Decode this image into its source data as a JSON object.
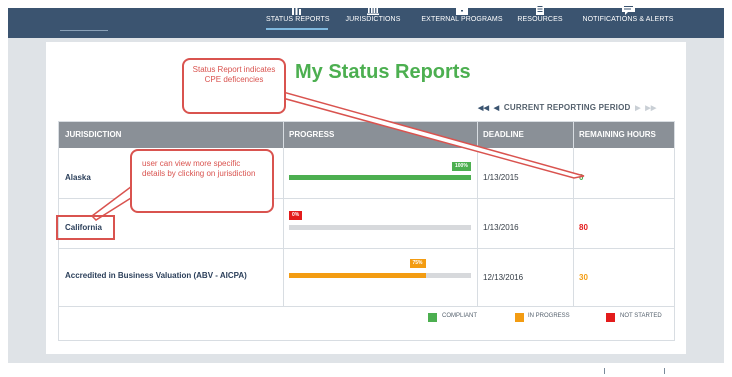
{
  "nav": {
    "items": [
      {
        "label": "STATUS REPORTS",
        "icon": "bar-chart-icon",
        "active": true
      },
      {
        "label": "JURISDICTIONS",
        "icon": "building-icon",
        "active": false
      },
      {
        "label": "EXTERNAL PROGRAMS",
        "icon": "briefcase-icon",
        "active": false
      },
      {
        "label": "RESOURCES",
        "icon": "document-icon",
        "active": false
      },
      {
        "label": "NOTIFICATIONS & ALERTS",
        "icon": "message-icon",
        "active": false
      }
    ]
  },
  "page": {
    "title": "My Status Reports",
    "period_label": "CURRENT REPORTING PERIOD"
  },
  "table": {
    "headers": [
      "JURISDICTION",
      "PROGRESS",
      "DEADLINE",
      "REMAINING HOURS"
    ],
    "rows": [
      {
        "jurisdiction": "Alaska",
        "progress_label": "100%",
        "progress": 1.0,
        "progress_color": "#4caf50",
        "deadline": "1/13/2015",
        "remaining": "0",
        "remaining_color": "#4caf50"
      },
      {
        "jurisdiction": "California",
        "progress_label": "0%",
        "progress": 0.0,
        "progress_color": "#e31b1b",
        "deadline": "1/13/2016",
        "remaining": "80",
        "remaining_color": "#e31b1b"
      },
      {
        "jurisdiction": "Accredited in Business  Valuation (ABV - AICPA)",
        "progress_label": "75%",
        "progress": 0.75,
        "progress_color": "#f39c12",
        "deadline": "12/13/2016",
        "remaining": "30",
        "remaining_color": "#f39c12"
      }
    ]
  },
  "legend": [
    {
      "label": "COMPLIANT",
      "color": "#4caf50"
    },
    {
      "label": "IN PROGRESS",
      "color": "#f39c12"
    },
    {
      "label": "NOT STARTED",
      "color": "#e31b1b"
    }
  ],
  "annotations": {
    "status_callout": "Status Report indicates CPE deficencies",
    "jurisdiction_callout": "user can view more specific details by clicking on jurisdiction"
  },
  "colors": {
    "nav_bg": "#3b5470",
    "title_green": "#4caf50",
    "annotation_red": "#d9534f",
    "header_gray": "#8a9097"
  }
}
